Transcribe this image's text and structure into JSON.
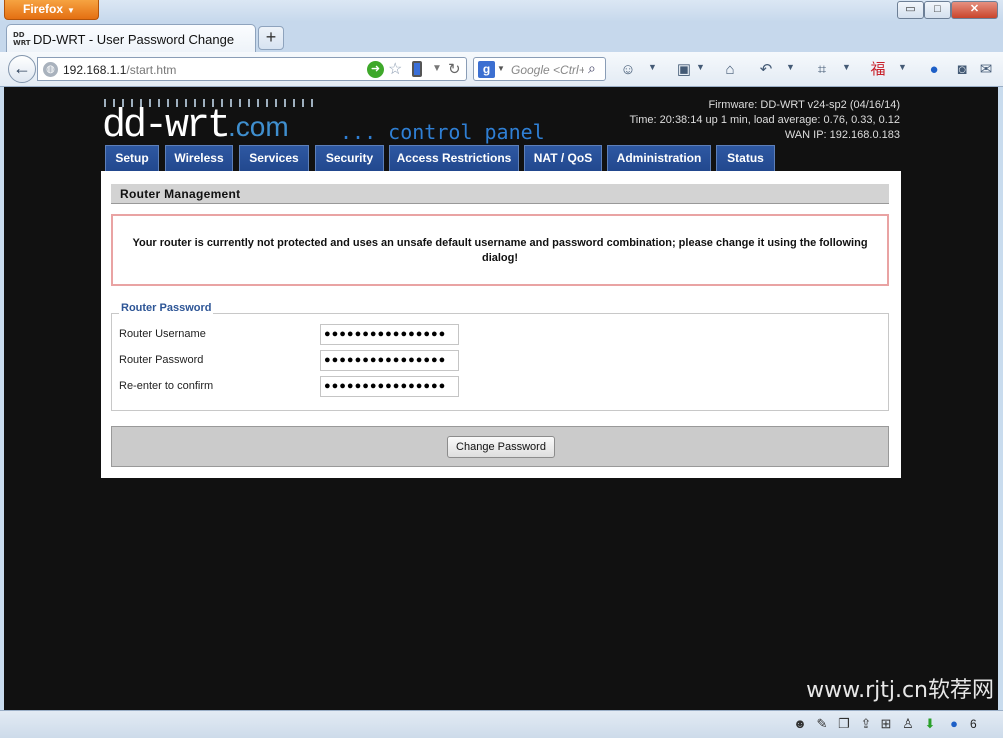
{
  "browser": {
    "menu_button": "Firefox",
    "window_controls": {
      "minimize": "▭",
      "maximize": "□",
      "close": "✕"
    },
    "tab": {
      "title": "DD-WRT - User Password Change",
      "favicon_text": "DD\nWRT"
    },
    "new_tab": "+",
    "url": {
      "host": "192.168.1.1",
      "path": "/start.htm"
    },
    "search": {
      "engine_icon": "g",
      "placeholder": "Google <Ctrl+K>"
    },
    "status_count": "6"
  },
  "header": {
    "logo_text": "dd-wrt",
    "logo_suffix": ".com",
    "panel_text": "... control panel",
    "firmware": "Firmware: DD-WRT v24-sp2 (04/16/14)",
    "time": "Time: 20:38:14 up 1 min, load average: 0.76, 0.33, 0.12",
    "wan_ip": "WAN IP: 192.168.0.183"
  },
  "nav": {
    "tabs": [
      "Setup",
      "Wireless",
      "Services",
      "Security",
      "Access Restrictions",
      "NAT / QoS",
      "Administration",
      "Status"
    ]
  },
  "main": {
    "section_title": "Router Management",
    "warning": "Your router is currently not protected and uses an unsafe default username and password combination; please change it using the following dialog!",
    "fieldset_legend": "Router Password",
    "fields": [
      {
        "label": "Router Username",
        "value": "●●●●●●●●●●●●●●●●"
      },
      {
        "label": "Router Password",
        "value": "●●●●●●●●●●●●●●●●"
      },
      {
        "label": "Re-enter to confirm",
        "value": "●●●●●●●●●●●●●●●●"
      }
    ],
    "submit_label": "Change Password"
  },
  "watermark": "www.rjtj.cn软荐网"
}
